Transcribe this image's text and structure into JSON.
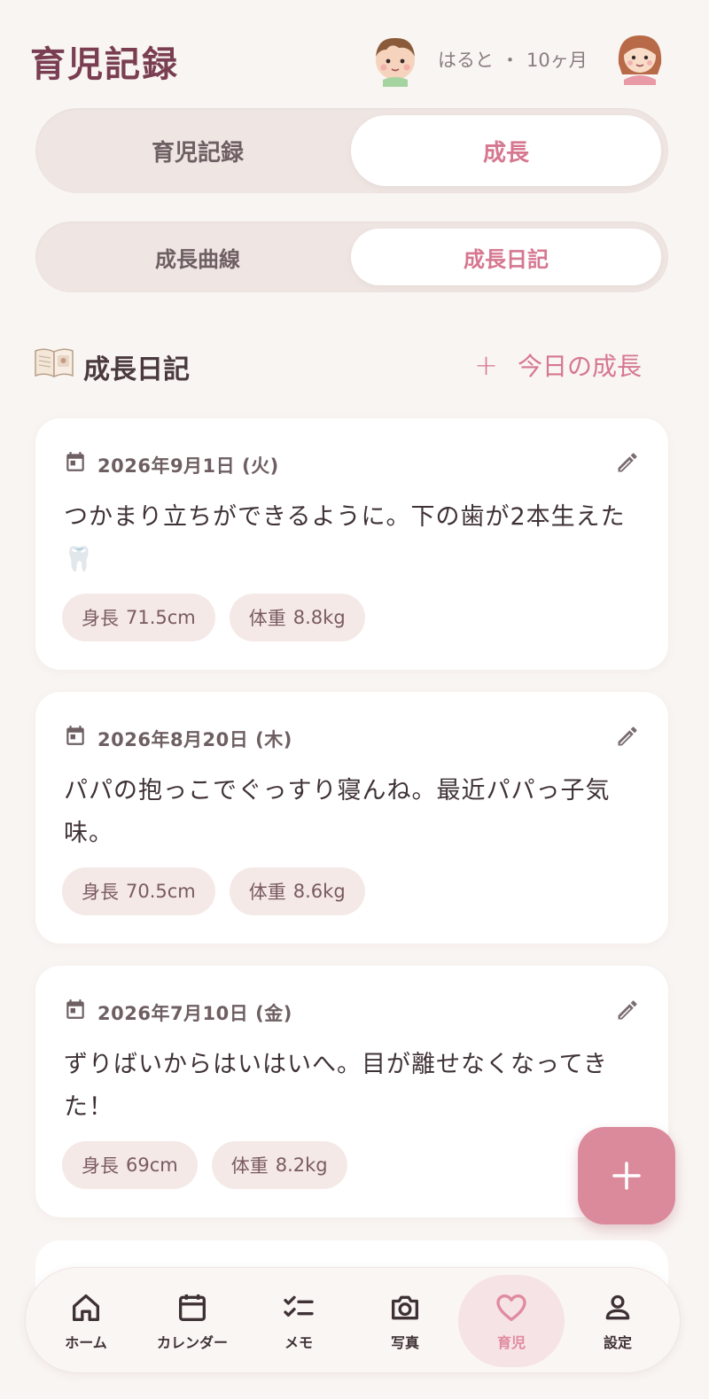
{
  "header": {
    "app_title": "育児記録",
    "child_name": "はると",
    "separator": "・",
    "child_age": "10ヶ月"
  },
  "main_tabs": [
    {
      "label": "育児記録",
      "active": false
    },
    {
      "label": "成長",
      "active": true
    }
  ],
  "sub_tabs": [
    {
      "label": "成長曲線",
      "active": false
    },
    {
      "label": "成長日記",
      "active": true
    }
  ],
  "section": {
    "icon": "book-icon",
    "title": "成長日記",
    "add_label": "今日の成長",
    "add_icon": "+"
  },
  "entries": [
    {
      "date": "2026年9月1日 (火)",
      "text": "つかまり立ちができるように。下の歯が2本生えた🦷",
      "height_label": "身長",
      "height_value": "71.5cm",
      "weight_label": "体重",
      "weight_value": "8.8kg"
    },
    {
      "date": "2026年8月20日 (木)",
      "text": "パパの抱っこでぐっすり寝んね。最近パパっ子気味。",
      "height_label": "身長",
      "height_value": "70.5cm",
      "weight_label": "体重",
      "weight_value": "8.6kg"
    },
    {
      "date": "2026年7月10日 (金)",
      "text": "ずりばいからはいはいへ。目が離せなくなってきた！",
      "height_label": "身長",
      "height_value": "69cm",
      "weight_label": "体重",
      "weight_value": "8.2kg"
    }
  ],
  "nav": [
    {
      "label": "ホーム",
      "icon": "home-icon",
      "active": false
    },
    {
      "label": "カレンダー",
      "icon": "calendar-icon",
      "active": false
    },
    {
      "label": "メモ",
      "icon": "checklist-icon",
      "active": false
    },
    {
      "label": "写真",
      "icon": "camera-icon",
      "active": false
    },
    {
      "label": "育児",
      "icon": "heart-icon",
      "active": true
    },
    {
      "label": "設定",
      "icon": "person-icon",
      "active": false
    }
  ],
  "colors": {
    "accent": "#d67790",
    "title": "#7a3e52",
    "background": "#f9f5f2",
    "chip": "#f4e9e6",
    "fab": "#db8a9c"
  }
}
